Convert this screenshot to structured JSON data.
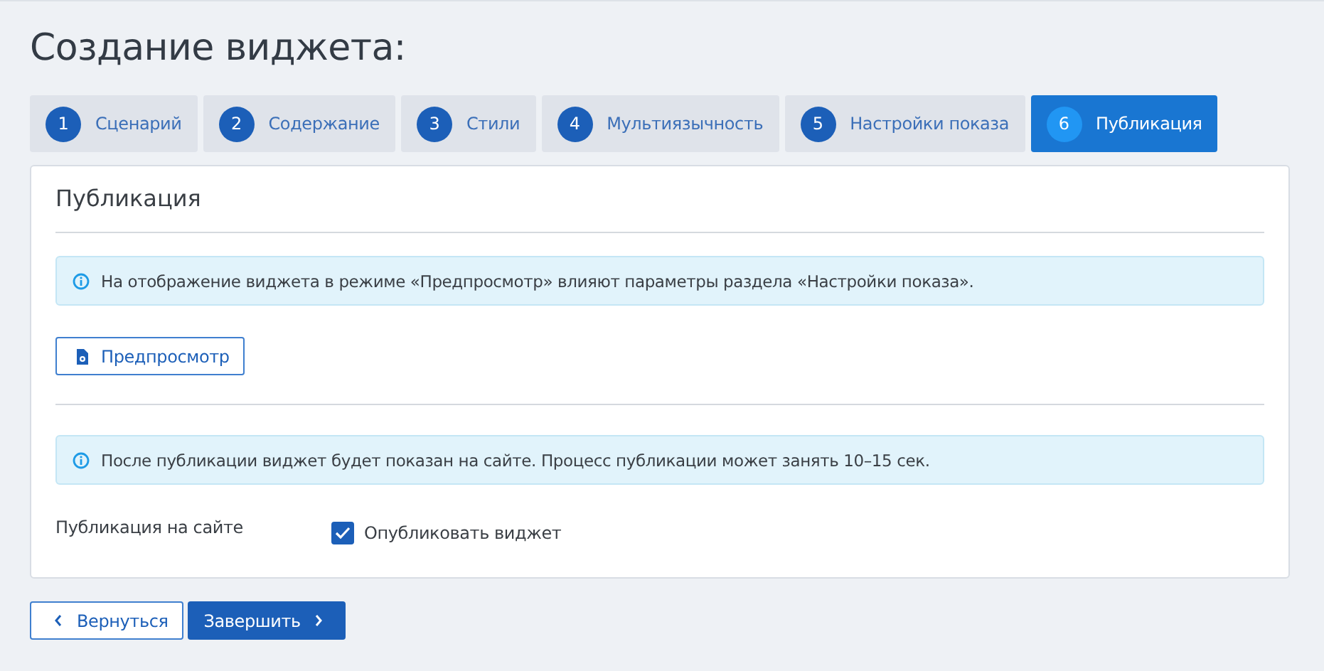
{
  "page_title": "Создание виджета:",
  "tabs": [
    {
      "number": "1",
      "label": "Сценарий",
      "selected": false
    },
    {
      "number": "2",
      "label": "Содержание",
      "selected": false
    },
    {
      "number": "3",
      "label": "Стили",
      "selected": false
    },
    {
      "number": "4",
      "label": "Мультиязычность",
      "selected": false
    },
    {
      "number": "5",
      "label": "Настройки показа",
      "selected": false
    },
    {
      "number": "6",
      "label": "Публикация",
      "selected": true
    }
  ],
  "card": {
    "title": "Публикация",
    "preview_notice": "На отображение виджета в режиме «Предпросмотр» влияют параметры раздела «Настройки показа».",
    "preview_button": "Предпросмотр",
    "publish_notice": "После публикации виджет будет показан на сайте. Процесс публикации может занять 10–15 сек.",
    "publish_label": "Публикация на сайте",
    "publish_checkbox": {
      "label": "Опубликовать виджет",
      "checked": true
    }
  },
  "footer": {
    "back_button": "Вернуться",
    "finish_button": "Завершить"
  }
}
